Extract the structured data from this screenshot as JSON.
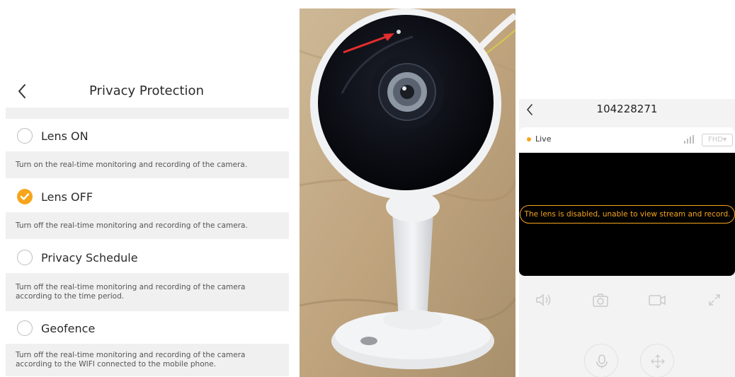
{
  "privacy": {
    "title": "Privacy Protection",
    "options": [
      {
        "label": "Lens ON",
        "checked": false,
        "description": [
          "Turn on the real-time monitoring and recording of the camera."
        ]
      },
      {
        "label": "Lens OFF",
        "checked": true,
        "description": [
          "Turn off the real-time monitoring and recording of the camera."
        ]
      },
      {
        "label": "Privacy Schedule",
        "checked": false,
        "description": [
          "Turn off the real-time monitoring and recording of the camera",
          "according to the time period."
        ]
      },
      {
        "label": "Geofence",
        "checked": false,
        "description": [
          "Turn off the real-time monitoring and recording of the camera",
          "according to the WIFI connected to the mobile phone."
        ]
      }
    ]
  },
  "live_view": {
    "device_title": "104228271",
    "live_label": "Live",
    "quality": "FHD▾",
    "lens_message": "The lens is disabled, unable to view stream and record."
  },
  "icons": {
    "back": "chevron-left-icon",
    "check": "check-icon",
    "signal": "signal-icon",
    "speaker": "speaker-icon",
    "camera": "camera-icon",
    "record": "video-record-icon",
    "fullscreen": "fullscreen-icon",
    "mic": "microphone-icon",
    "ptz": "move-arrows-icon"
  },
  "colors": {
    "accent": "#f7a51c",
    "section_bg": "#f0f0f0",
    "video_bg": "#000000"
  }
}
